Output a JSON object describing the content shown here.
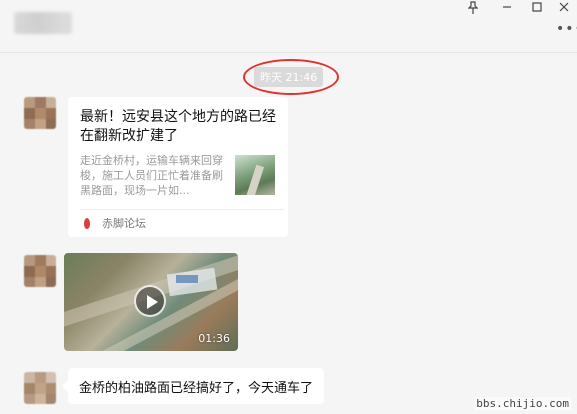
{
  "window": {
    "controls": {
      "pin": "pin-icon",
      "minimize": "minimize-icon",
      "maximize": "maximize-icon",
      "close": "close-icon",
      "more": "more-icon"
    }
  },
  "chat": {
    "timestamp": "昨天 21:46",
    "messages": [
      {
        "type": "article",
        "title": "最新！远安县这个地方的路已经在翻新改扩建了",
        "description": "走近金桥村，运输车辆来回穿梭，施工人员们正忙着准备刷黑路面，现场一片如...",
        "source": "赤脚论坛",
        "source_icon": "footprint-icon"
      },
      {
        "type": "video",
        "duration": "01:36",
        "icon": "play-icon"
      },
      {
        "type": "text",
        "text": "金桥的柏油路面已经搞好了，今天通车了"
      }
    ]
  },
  "watermark": "bbs.chijio.com",
  "colors": {
    "highlight_ring": "#e0312f",
    "source_icon": "#d9413a"
  }
}
